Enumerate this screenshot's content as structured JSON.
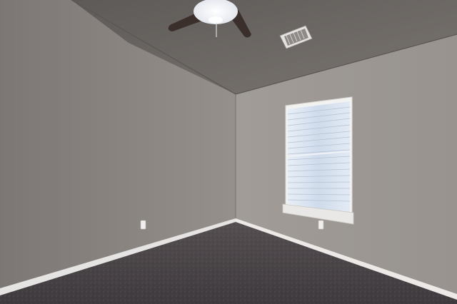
{
  "scene": {
    "subject": "empty-room-interior",
    "elements": [
      "vaulted-ceiling",
      "ceiling-fan",
      "air-vent",
      "left-wall",
      "right-wall",
      "window-with-blinds",
      "baseboards",
      "electrical-outlets",
      "carpet-floor"
    ],
    "colors": {
      "left_wall": "#8c8784",
      "right_wall": "#a39e9a",
      "ceiling": "#6d6966",
      "carpet": "#4b4548",
      "baseboard": "#e8e6e4",
      "window_blinds": "#d7e1ef",
      "fan_blade": "#3a2f2b",
      "fan_light": "#f6f7fa"
    }
  }
}
